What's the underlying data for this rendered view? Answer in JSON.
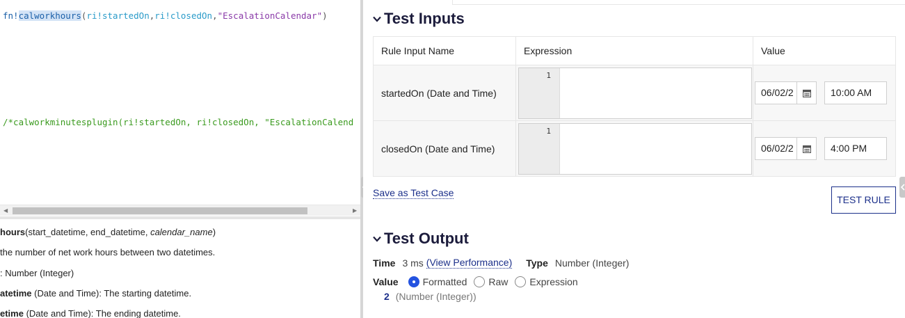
{
  "editor": {
    "line1": {
      "prefix": "fn!",
      "func": "calworkhours",
      "open": "(",
      "arg1": "ri!startedOn",
      "comma1": ",",
      "arg2": "ri!closedOn",
      "comma2": ",",
      "arg3": "\"EscalationCalendar\"",
      "close": ")"
    },
    "line2": "/*calworkminutesplugin(ri!startedOn, ri!closedOn, \"EscalationCalend"
  },
  "help": {
    "sig_name": "hours",
    "sig_args": "(start_datetime, end_datetime, ",
    "sig_opt": "calendar_name",
    "sig_end": ")",
    "desc": "the number of net work hours between two datetimes.",
    "returns": ": Number (Integer)",
    "param1_name": "atetime",
    "param1_desc": " (Date and Time): The starting datetime.",
    "param2_name": "etime",
    "param2_desc": " (Date and Time): The ending datetime."
  },
  "test_inputs": {
    "title": "Test Inputs",
    "columns": [
      "Rule Input Name",
      "Expression",
      "Value"
    ],
    "rows": [
      {
        "name": "startedOn (Date and Time)",
        "line_no": "1",
        "date": "06/02/2",
        "time": "10:00 AM"
      },
      {
        "name": "closedOn (Date and Time)",
        "line_no": "1",
        "date": "06/02/2",
        "time": "4:00 PM"
      }
    ],
    "save_link": "Save as Test Case",
    "test_button": "TEST RULE"
  },
  "test_output": {
    "title": "Test Output",
    "time_label": "Time",
    "time_value": "3 ms",
    "view_perf": "(View Performance)",
    "type_label": "Type",
    "type_value": "Number (Integer)",
    "value_label": "Value",
    "radio_options": [
      "Formatted",
      "Raw",
      "Expression"
    ],
    "selected": "Formatted",
    "result_value": "2",
    "result_type": "(Number (Integer))"
  },
  "icons": {
    "section_toggle": "chevron-down-icon",
    "calendar": "calendar-icon",
    "collapse": "collapse-arrow-icon"
  },
  "colors": {
    "accent": "#1b2f8a",
    "radio_selected": "#2453e0",
    "comment": "#3a9a1e",
    "string": "#8a3aa8"
  }
}
